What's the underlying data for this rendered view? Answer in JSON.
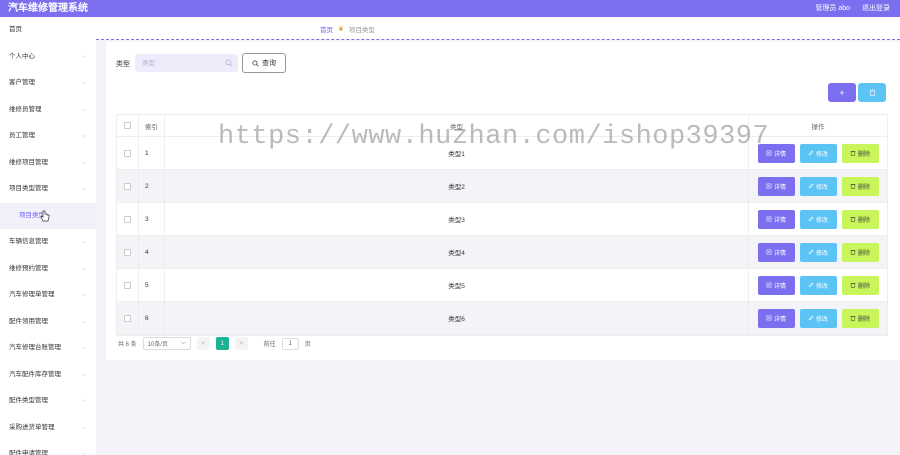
{
  "header": {
    "app_title": "汽车维修管理系统",
    "admin_label": "管理员 abo",
    "logout_label": "退出登录"
  },
  "sidebar": {
    "items": [
      {
        "label": "首页",
        "has_arrow": false
      },
      {
        "label": "个人中心",
        "has_arrow": true
      },
      {
        "label": "客户管理",
        "has_arrow": true
      },
      {
        "label": "维修员管理",
        "has_arrow": true
      },
      {
        "label": "员工管理",
        "has_arrow": true
      },
      {
        "label": "维修项目管理",
        "has_arrow": true
      },
      {
        "label": "项目类型管理",
        "has_arrow": true
      },
      {
        "label": "项目类型",
        "has_arrow": false,
        "sub": true
      },
      {
        "label": "车辆信息管理",
        "has_arrow": true
      },
      {
        "label": "维修预约管理",
        "has_arrow": true
      },
      {
        "label": "汽车修理单管理",
        "has_arrow": true
      },
      {
        "label": "配件领用管理",
        "has_arrow": true
      },
      {
        "label": "汽车修理台账管理",
        "has_arrow": true
      },
      {
        "label": "汽车配件库存管理",
        "has_arrow": true
      },
      {
        "label": "配件类型管理",
        "has_arrow": true
      },
      {
        "label": "采购进货单管理",
        "has_arrow": true
      },
      {
        "label": "配件申请管理",
        "has_arrow": true
      }
    ]
  },
  "breadcrumb": {
    "home": "首页",
    "current": "项目类型"
  },
  "search": {
    "label": "类型",
    "placeholder": "类型",
    "query_label": "查询"
  },
  "toolbar": {
    "add_label": "+"
  },
  "table": {
    "headers": {
      "index": "索引",
      "type": "类型",
      "ops": "操作"
    },
    "rows": [
      {
        "index": "1",
        "type": "类型1"
      },
      {
        "index": "2",
        "type": "类型2"
      },
      {
        "index": "3",
        "type": "类型3"
      },
      {
        "index": "4",
        "type": "类型4"
      },
      {
        "index": "5",
        "type": "类型5"
      },
      {
        "index": "6",
        "type": "类型6"
      }
    ],
    "ops": {
      "detail": "详情",
      "edit": "修改",
      "delete": "删除"
    }
  },
  "pagination": {
    "total": "共 6 条",
    "page_size": "10条/页",
    "prev": "<",
    "current_page": "1",
    "next": ">",
    "goto_prefix": "前往",
    "goto_value": "1",
    "goto_suffix": "页"
  },
  "watermark": "https://www.huzhan.com/ishop39397",
  "colors": {
    "accent": "#7b6ff0",
    "edit": "#5cc3f5",
    "delete": "#c7f55a",
    "active_page": "#1bb394"
  }
}
